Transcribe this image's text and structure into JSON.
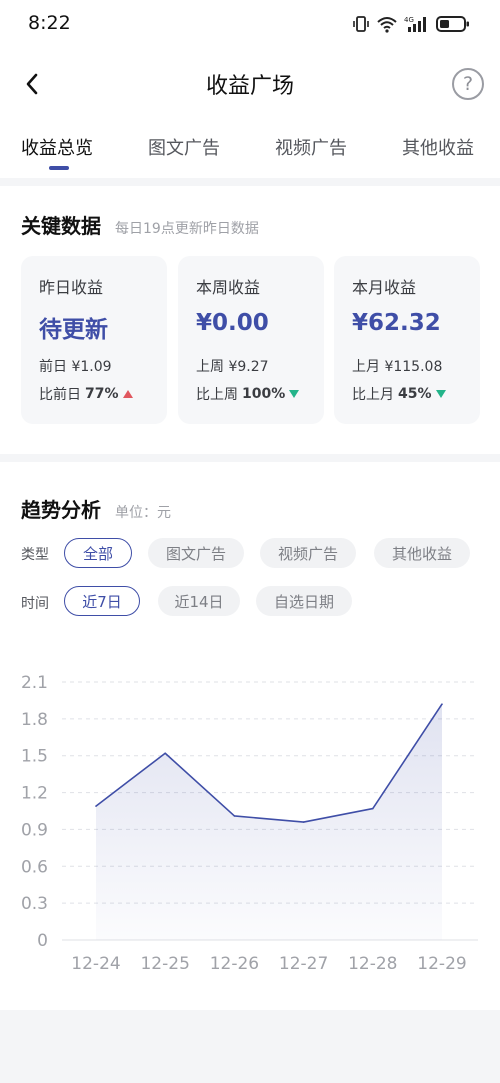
{
  "status": {
    "time": "8:22",
    "network": "4G"
  },
  "nav": {
    "title": "收益广场",
    "help_glyph": "?"
  },
  "tabs": [
    {
      "label": "收益总览",
      "active": true
    },
    {
      "label": "图文广告",
      "active": false
    },
    {
      "label": "视频广告",
      "active": false
    },
    {
      "label": "其他收益",
      "active": false
    }
  ],
  "key_data": {
    "title": "关键数据",
    "subtitle": "每日19点更新昨日数据",
    "cards": [
      {
        "label": "昨日收益",
        "value": "待更新",
        "prev_label": "前日",
        "prev_value": "¥1.09",
        "compare_label": "比前日",
        "compare_value": "77%",
        "trend": "up"
      },
      {
        "label": "本周收益",
        "value": "¥0.00",
        "prev_label": "上周",
        "prev_value": "¥9.27",
        "compare_label": "比上周",
        "compare_value": "100%",
        "trend": "down"
      },
      {
        "label": "本月收益",
        "value": "¥62.32",
        "prev_label": "上月",
        "prev_value": "¥115.08",
        "compare_label": "比上月",
        "compare_value": "45%",
        "trend": "down"
      }
    ]
  },
  "trend": {
    "title": "趋势分析",
    "unit": "单位：元",
    "type_label": "类型",
    "type_options": [
      {
        "label": "全部",
        "active": true
      },
      {
        "label": "图文广告",
        "active": false
      },
      {
        "label": "视频广告",
        "active": false
      },
      {
        "label": "其他收益",
        "active": false
      }
    ],
    "time_label": "时间",
    "time_options": [
      {
        "label": "近7日",
        "active": true
      },
      {
        "label": "近14日",
        "active": false
      },
      {
        "label": "自选日期",
        "active": false
      }
    ]
  },
  "colors": {
    "accent": "#3f4ea7",
    "up": "#e0575f",
    "down": "#23b48a"
  },
  "chart_data": {
    "type": "area",
    "categories": [
      "12-24",
      "12-25",
      "12-26",
      "12-27",
      "12-28",
      "12-29"
    ],
    "values": [
      1.09,
      1.52,
      1.01,
      0.96,
      1.07,
      1.92
    ],
    "yticks": [
      "0",
      "0.3",
      "0.6",
      "0.9",
      "1.2",
      "1.5",
      "1.8",
      "2.1"
    ],
    "ylim": [
      0,
      2.1
    ],
    "grid": true
  }
}
